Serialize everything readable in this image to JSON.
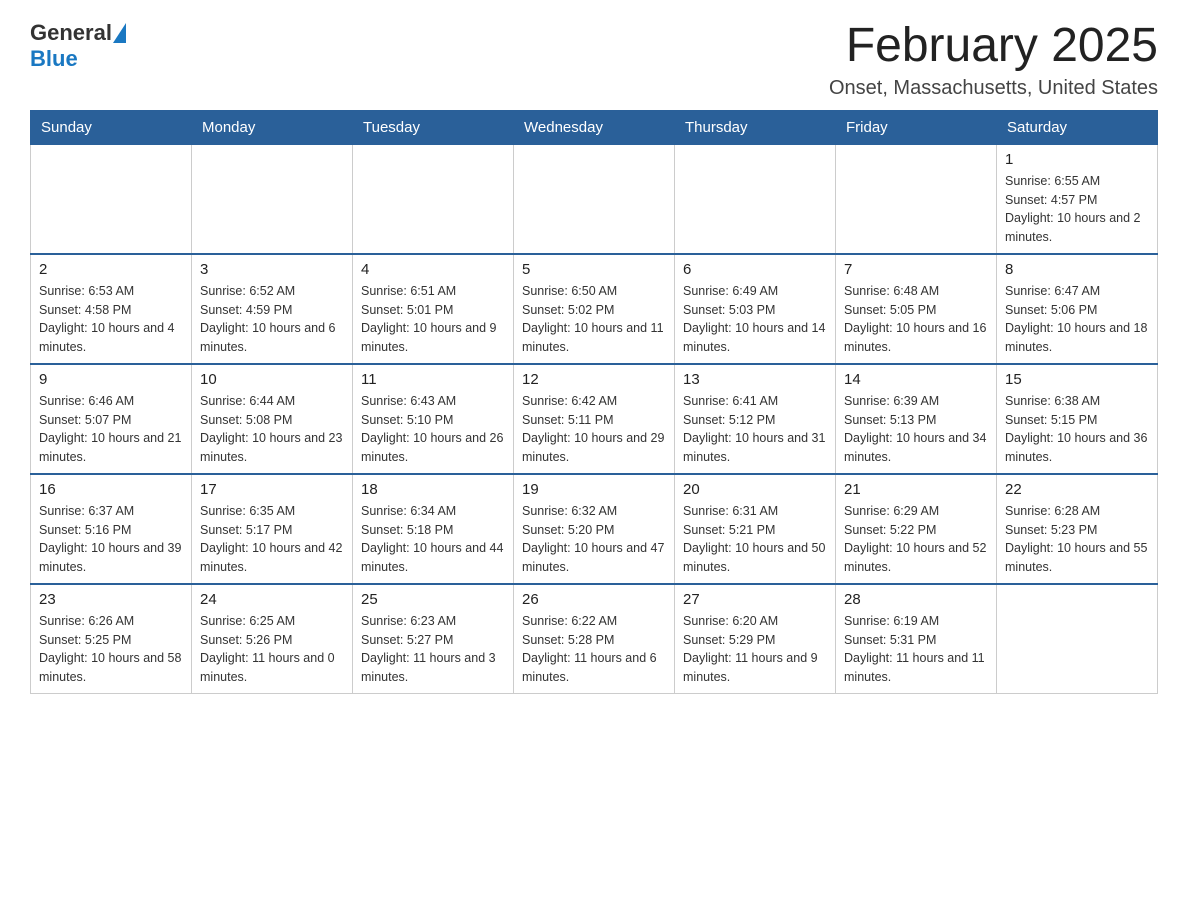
{
  "header": {
    "logo_general": "General",
    "logo_blue": "Blue",
    "title": "February 2025",
    "location": "Onset, Massachusetts, United States"
  },
  "weekdays": [
    "Sunday",
    "Monday",
    "Tuesday",
    "Wednesday",
    "Thursday",
    "Friday",
    "Saturday"
  ],
  "weeks": [
    [
      {
        "day": "",
        "info": ""
      },
      {
        "day": "",
        "info": ""
      },
      {
        "day": "",
        "info": ""
      },
      {
        "day": "",
        "info": ""
      },
      {
        "day": "",
        "info": ""
      },
      {
        "day": "",
        "info": ""
      },
      {
        "day": "1",
        "info": "Sunrise: 6:55 AM\nSunset: 4:57 PM\nDaylight: 10 hours and 2 minutes."
      }
    ],
    [
      {
        "day": "2",
        "info": "Sunrise: 6:53 AM\nSunset: 4:58 PM\nDaylight: 10 hours and 4 minutes."
      },
      {
        "day": "3",
        "info": "Sunrise: 6:52 AM\nSunset: 4:59 PM\nDaylight: 10 hours and 6 minutes."
      },
      {
        "day": "4",
        "info": "Sunrise: 6:51 AM\nSunset: 5:01 PM\nDaylight: 10 hours and 9 minutes."
      },
      {
        "day": "5",
        "info": "Sunrise: 6:50 AM\nSunset: 5:02 PM\nDaylight: 10 hours and 11 minutes."
      },
      {
        "day": "6",
        "info": "Sunrise: 6:49 AM\nSunset: 5:03 PM\nDaylight: 10 hours and 14 minutes."
      },
      {
        "day": "7",
        "info": "Sunrise: 6:48 AM\nSunset: 5:05 PM\nDaylight: 10 hours and 16 minutes."
      },
      {
        "day": "8",
        "info": "Sunrise: 6:47 AM\nSunset: 5:06 PM\nDaylight: 10 hours and 18 minutes."
      }
    ],
    [
      {
        "day": "9",
        "info": "Sunrise: 6:46 AM\nSunset: 5:07 PM\nDaylight: 10 hours and 21 minutes."
      },
      {
        "day": "10",
        "info": "Sunrise: 6:44 AM\nSunset: 5:08 PM\nDaylight: 10 hours and 23 minutes."
      },
      {
        "day": "11",
        "info": "Sunrise: 6:43 AM\nSunset: 5:10 PM\nDaylight: 10 hours and 26 minutes."
      },
      {
        "day": "12",
        "info": "Sunrise: 6:42 AM\nSunset: 5:11 PM\nDaylight: 10 hours and 29 minutes."
      },
      {
        "day": "13",
        "info": "Sunrise: 6:41 AM\nSunset: 5:12 PM\nDaylight: 10 hours and 31 minutes."
      },
      {
        "day": "14",
        "info": "Sunrise: 6:39 AM\nSunset: 5:13 PM\nDaylight: 10 hours and 34 minutes."
      },
      {
        "day": "15",
        "info": "Sunrise: 6:38 AM\nSunset: 5:15 PM\nDaylight: 10 hours and 36 minutes."
      }
    ],
    [
      {
        "day": "16",
        "info": "Sunrise: 6:37 AM\nSunset: 5:16 PM\nDaylight: 10 hours and 39 minutes."
      },
      {
        "day": "17",
        "info": "Sunrise: 6:35 AM\nSunset: 5:17 PM\nDaylight: 10 hours and 42 minutes."
      },
      {
        "day": "18",
        "info": "Sunrise: 6:34 AM\nSunset: 5:18 PM\nDaylight: 10 hours and 44 minutes."
      },
      {
        "day": "19",
        "info": "Sunrise: 6:32 AM\nSunset: 5:20 PM\nDaylight: 10 hours and 47 minutes."
      },
      {
        "day": "20",
        "info": "Sunrise: 6:31 AM\nSunset: 5:21 PM\nDaylight: 10 hours and 50 minutes."
      },
      {
        "day": "21",
        "info": "Sunrise: 6:29 AM\nSunset: 5:22 PM\nDaylight: 10 hours and 52 minutes."
      },
      {
        "day": "22",
        "info": "Sunrise: 6:28 AM\nSunset: 5:23 PM\nDaylight: 10 hours and 55 minutes."
      }
    ],
    [
      {
        "day": "23",
        "info": "Sunrise: 6:26 AM\nSunset: 5:25 PM\nDaylight: 10 hours and 58 minutes."
      },
      {
        "day": "24",
        "info": "Sunrise: 6:25 AM\nSunset: 5:26 PM\nDaylight: 11 hours and 0 minutes."
      },
      {
        "day": "25",
        "info": "Sunrise: 6:23 AM\nSunset: 5:27 PM\nDaylight: 11 hours and 3 minutes."
      },
      {
        "day": "26",
        "info": "Sunrise: 6:22 AM\nSunset: 5:28 PM\nDaylight: 11 hours and 6 minutes."
      },
      {
        "day": "27",
        "info": "Sunrise: 6:20 AM\nSunset: 5:29 PM\nDaylight: 11 hours and 9 minutes."
      },
      {
        "day": "28",
        "info": "Sunrise: 6:19 AM\nSunset: 5:31 PM\nDaylight: 11 hours and 11 minutes."
      },
      {
        "day": "",
        "info": ""
      }
    ]
  ]
}
